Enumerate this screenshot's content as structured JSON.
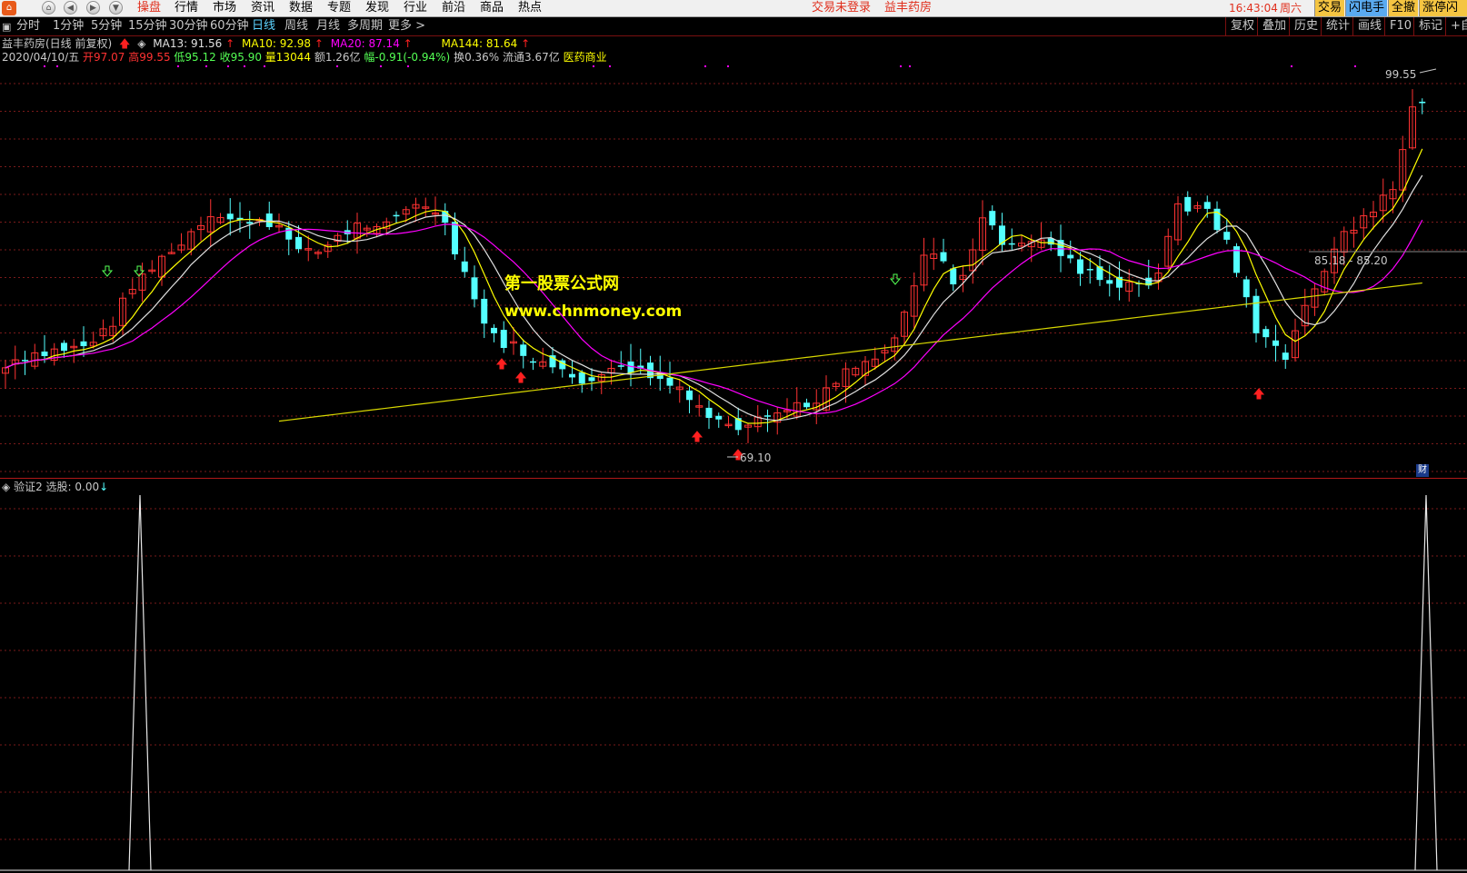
{
  "menubar": {
    "items": [
      "操盘",
      "行情",
      "市场",
      "资讯",
      "数据",
      "专题",
      "发现",
      "行业",
      "前沿",
      "商品",
      "热点"
    ],
    "active_index": 0,
    "login_status": "交易未登录",
    "stock_name": "益丰药房",
    "time": "16:43:04",
    "weekday": "周六",
    "right_buttons": [
      "交易",
      "闪电手",
      "全撤",
      "涨停闪买"
    ]
  },
  "toolbar": {
    "periods": [
      "分时",
      "1分钟",
      "5分钟",
      "15分钟",
      "30分钟",
      "60分钟",
      "日线",
      "周线",
      "月线",
      "多周期",
      "更多 >"
    ],
    "active_period": "日线",
    "right_buttons": [
      "复权",
      "叠加",
      "历史",
      "统计",
      "画线",
      "F10",
      "标记",
      "+自"
    ]
  },
  "info": {
    "title": "益丰药房(日线 前复权)",
    "ma13": "MA13: 91.56",
    "ma10": "MA10: 92.98",
    "ma20": "MA20: 87.14",
    "ma144": "MA144: 81.64",
    "date": "2020/04/10/五",
    "open": "开97.07",
    "high": "高99.55",
    "low": "低95.12",
    "close": "收95.90",
    "volume": "量13044",
    "amount": "额1.26亿",
    "change": "幅-0.91(-0.94%)",
    "turnover": "换0.36%",
    "float": "流通3.67亿",
    "sector": "医药商业"
  },
  "chart_data": {
    "type": "candlestick",
    "annotations": {
      "high_label": "99.55",
      "low_label": "69.10",
      "range_label": "85.18 - 85.20",
      "finance_badge": "财"
    },
    "watermark": [
      "第一股票公式网",
      "www.chnmoney.com"
    ],
    "indicator": {
      "title": "验证2",
      "field": "选股: 0.00",
      "spikes_at_candle_index": [
        12,
        123
      ]
    }
  },
  "colors": {
    "up": "#ff3232",
    "down": "#54ffff",
    "ma_white": "#e0e0e0",
    "ma_yellow": "#ffff00",
    "ma_magenta": "#ff00ff",
    "ma_long": "#d8d800",
    "grid": "#7a1a1a"
  }
}
